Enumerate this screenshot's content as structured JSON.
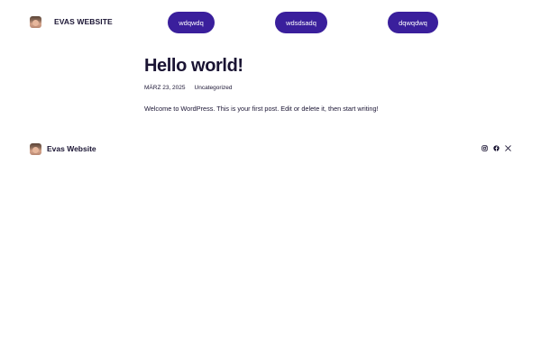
{
  "header": {
    "site_title": "EVAS WEBSITE",
    "logo_icon": "avatar-photo",
    "nav": [
      {
        "label": "wdqwdq"
      },
      {
        "label": "wdsdsadq"
      },
      {
        "label": "dqwqdwq"
      }
    ]
  },
  "post": {
    "title": "Hello world!",
    "date": "MÄRZ 23, 2025",
    "category": "Uncategorized",
    "excerpt": "Welcome to WordPress. This is your first post. Edit or delete it, then start writing!"
  },
  "footer": {
    "site_name": "Evas Website",
    "social_icons": [
      "instagram-icon",
      "facebook-icon",
      "x-icon"
    ]
  },
  "colors": {
    "accent": "#3a1f9c",
    "text": "#1a1433",
    "background": "#ffffff"
  }
}
